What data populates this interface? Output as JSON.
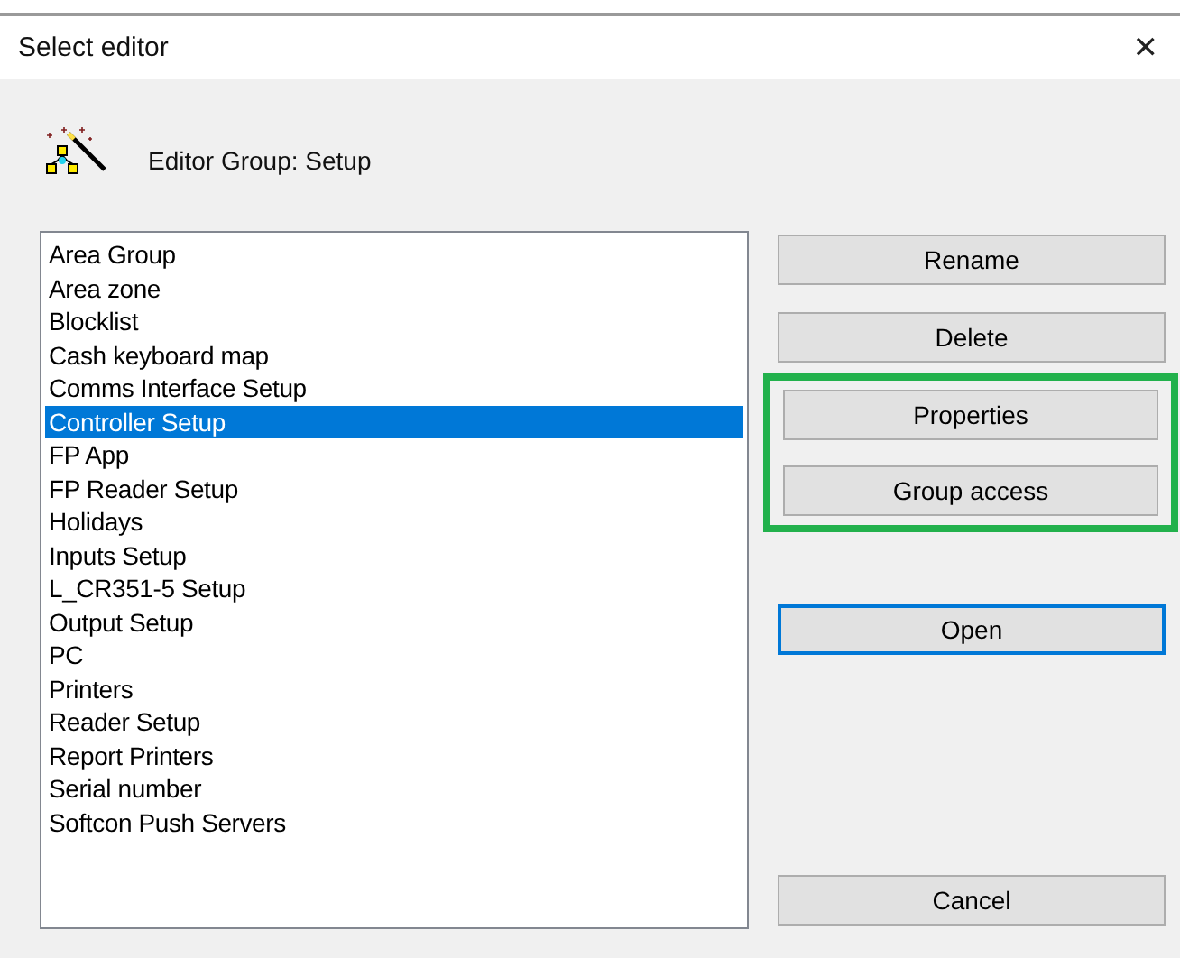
{
  "window": {
    "title": "Select editor",
    "close": "✕"
  },
  "header": {
    "label": "Editor Group: Setup"
  },
  "list": {
    "items": [
      {
        "label": "Area Group",
        "selected": false
      },
      {
        "label": "Area zone",
        "selected": false
      },
      {
        "label": "Blocklist",
        "selected": false
      },
      {
        "label": "Cash keyboard map",
        "selected": false
      },
      {
        "label": "Comms Interface Setup",
        "selected": false
      },
      {
        "label": "Controller Setup",
        "selected": true
      },
      {
        "label": "FP App",
        "selected": false
      },
      {
        "label": "FP Reader Setup",
        "selected": false
      },
      {
        "label": "Holidays",
        "selected": false
      },
      {
        "label": "Inputs Setup",
        "selected": false
      },
      {
        "label": "L_CR351-5 Setup",
        "selected": false
      },
      {
        "label": "Output Setup",
        "selected": false
      },
      {
        "label": "PC",
        "selected": false
      },
      {
        "label": "Printers",
        "selected": false
      },
      {
        "label": "Reader Setup",
        "selected": false
      },
      {
        "label": "Report Printers",
        "selected": false
      },
      {
        "label": "Serial number",
        "selected": false
      },
      {
        "label": "Softcon Push Servers",
        "selected": false
      }
    ]
  },
  "buttons": [
    {
      "label": "Rename",
      "default": false,
      "highlighted": false
    },
    {
      "label": "Delete",
      "default": false,
      "highlighted": false
    },
    {
      "label": "Properties",
      "default": false,
      "highlighted": true
    },
    {
      "label": "Group access",
      "default": false,
      "highlighted": true
    },
    {
      "label": "Open",
      "default": true,
      "highlighted": false
    },
    {
      "label": "Cancel",
      "default": false,
      "highlighted": false
    }
  ]
}
